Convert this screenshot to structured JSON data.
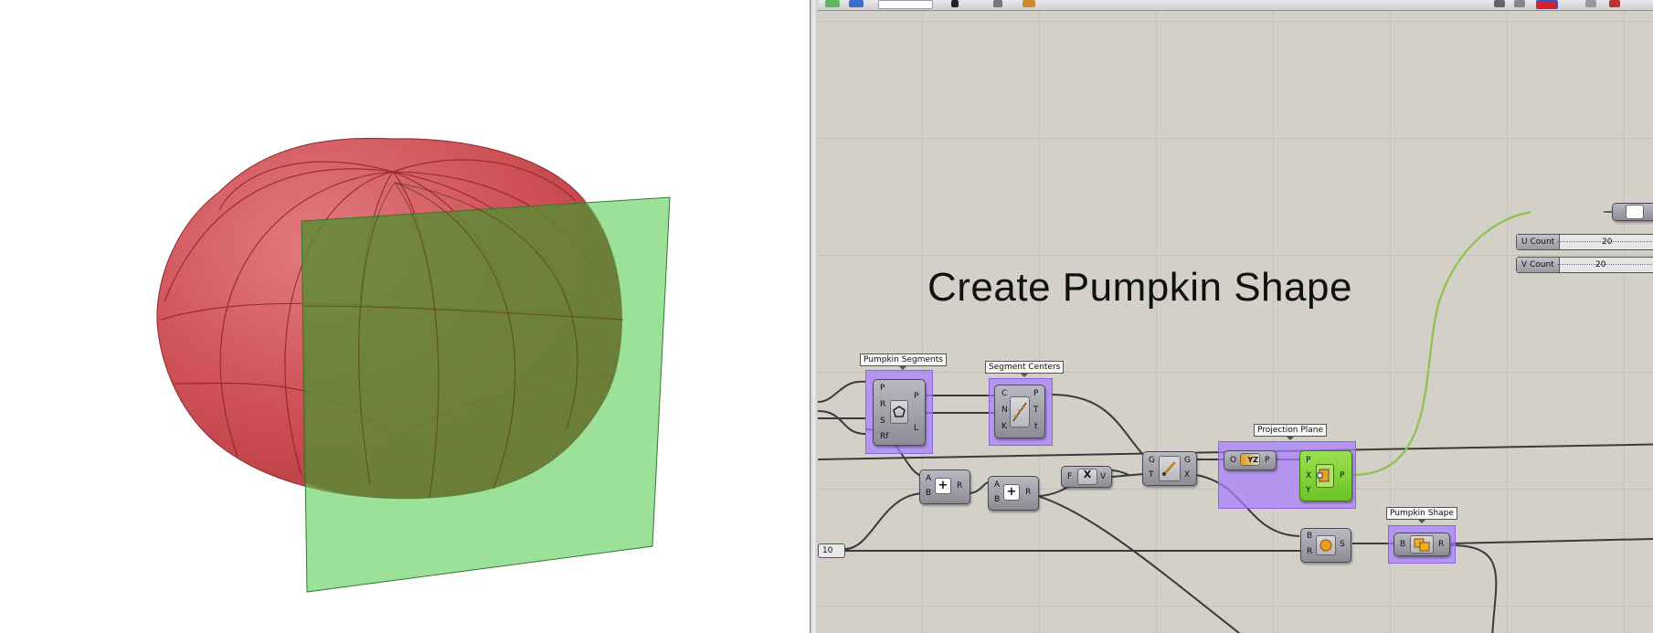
{
  "canvas": {
    "title": "Create Pumpkin Shape"
  },
  "labels": {
    "pumpkin_segments": "Pumpkin Segments",
    "segment_centers": "Segment Centers",
    "projection_plane": "Projection Plane",
    "pumpkin_shape": "Pumpkin Shape"
  },
  "components": {
    "polygon": {
      "inputs": [
        "P",
        "R",
        "S",
        "Rf"
      ],
      "outputs": [
        "P",
        "L"
      ],
      "icon": "polygon-icon"
    },
    "divide": {
      "inputs": [
        "C",
        "N",
        "K"
      ],
      "outputs": [
        "P",
        "T",
        "t"
      ],
      "icon": "divide-curve-icon"
    },
    "addition_1": {
      "inputs": [
        "A",
        "B"
      ],
      "outputs": [
        "R"
      ],
      "icon": "plus-icon"
    },
    "addition_2": {
      "inputs": [
        "A",
        "B"
      ],
      "outputs": [
        "R"
      ],
      "icon": "plus-icon"
    },
    "expression": {
      "inputs": [
        "F"
      ],
      "outputs": [
        "V"
      ],
      "icon": "expression-icon"
    },
    "move": {
      "inputs": [
        "G",
        "T"
      ],
      "outputs": [
        "G",
        "X"
      ],
      "icon": "move-icon"
    },
    "yz_plane": {
      "inputs": [
        "O"
      ],
      "outputs": [
        "P"
      ],
      "icon": "yz-plane-icon",
      "text": "YZ"
    },
    "plane_srf": {
      "inputs": [
        "P",
        "X",
        "Y"
      ],
      "outputs": [
        "P"
      ],
      "icon": "plane-surface-icon"
    },
    "sphere": {
      "inputs": [
        "B",
        "R"
      ],
      "outputs": [
        "S"
      ],
      "icon": "sphere-icon"
    },
    "morph": {
      "inputs": [
        "B"
      ],
      "outputs": [
        "R"
      ],
      "icon": "boolean-union-icon"
    }
  },
  "sliders": [
    {
      "name": "U Count",
      "value": "20"
    },
    {
      "name": "V Count",
      "value": "20"
    }
  ],
  "number_panel": {
    "value": "10"
  },
  "colors": {
    "pumpkin": "#c8464b",
    "plane": "#7bd67a",
    "canvas": "#d3d0c8",
    "group": "#a880ff",
    "selected_component": "#7cc82e",
    "selected_wire": "#8bc34a"
  }
}
